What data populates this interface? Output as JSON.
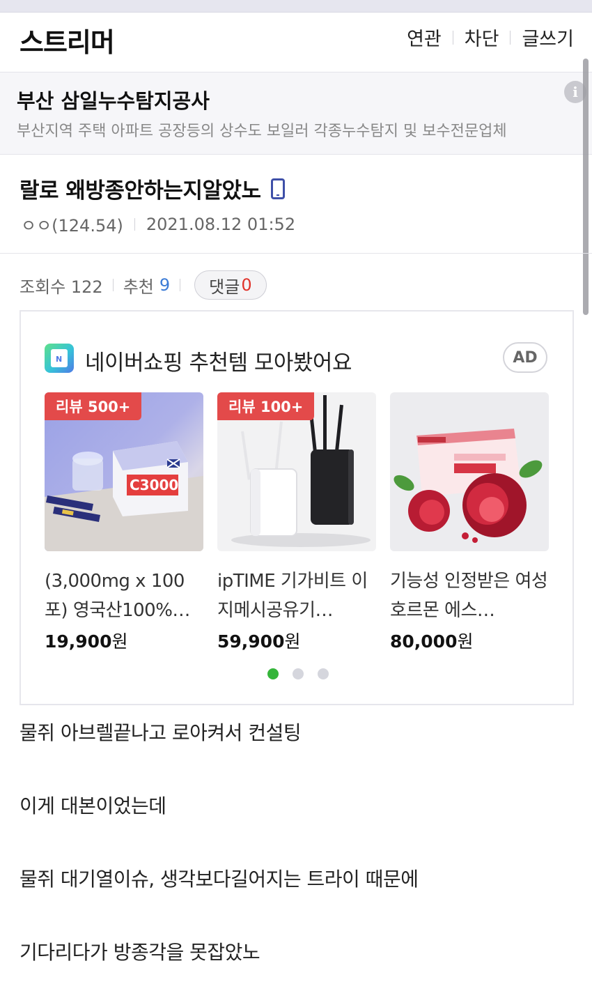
{
  "header": {
    "brand": "스트리머",
    "nav": [
      "연관",
      "차단",
      "글쓰기"
    ]
  },
  "ad_banner": {
    "title": "부산 삼일누수탐지공사",
    "description": "부산지역 주택 아파트 공장등의 상수도 보일러 각종누수탐지 및 보수전문업체",
    "info_icon": "i"
  },
  "post": {
    "title": "랄로 왜방종안하는지알았노",
    "author": "ㅇㅇ(124.54)",
    "date": "2021.08.12 01:52"
  },
  "stats": {
    "views_label": "조회수 122",
    "recommend_label": "추천",
    "recommend_count": "9",
    "comments_label": "댓글",
    "comments_count": "0"
  },
  "shopping": {
    "title": "네이버쇼핑 추천템 모아봤어요",
    "ad_label": "AD",
    "products": [
      {
        "badge": "리뷰 500+",
        "name": "(3,000mg x 100포) 영국산100%…",
        "price": "19,900",
        "unit": "원"
      },
      {
        "badge": "리뷰 100+",
        "name": "ipTIME 기가비트 이지메시공유기…",
        "price": "59,900",
        "unit": "원"
      },
      {
        "badge": "",
        "name": "기능성 인정받은 여성 호르몬 에스…",
        "price": "80,000",
        "unit": "원"
      }
    ],
    "page_dots": 3,
    "active_dot": 0
  },
  "body": {
    "lines": [
      "물쥐 아브렐끝나고 로아켜서 컨설팅",
      "이게 대본이었는데",
      "물쥐 대기열이슈, 생각보다길어지는 트라이 때문에",
      "기다리다가 방종각을 못잡았노"
    ]
  },
  "colors": {
    "accent_blue": "#3b7bd6",
    "accent_red": "#e0332b",
    "badge_red": "#e34a4a",
    "dot_active": "#35b53a"
  }
}
